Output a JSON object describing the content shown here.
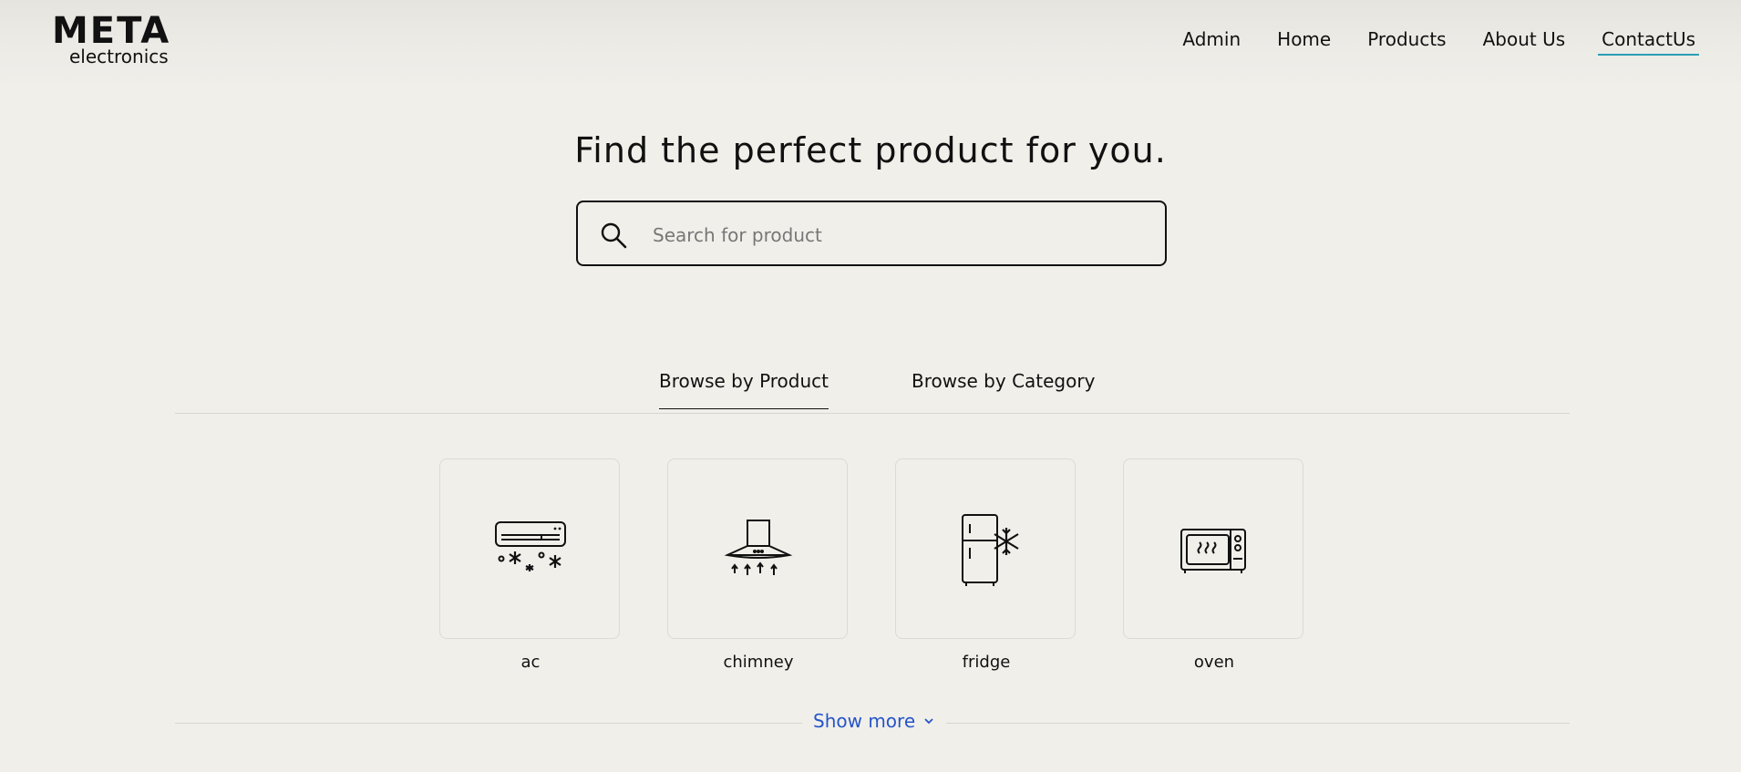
{
  "brand": {
    "name": "META",
    "sub": "electronics"
  },
  "nav": {
    "items": [
      {
        "label": "Admin"
      },
      {
        "label": "Home"
      },
      {
        "label": "Products"
      },
      {
        "label": "About Us"
      },
      {
        "label": "ContactUs",
        "active": true
      }
    ],
    "active_underline_color": "#2a9fb5"
  },
  "hero": {
    "title": "Find the perfect product for you."
  },
  "search": {
    "placeholder": "Search for product",
    "value": "",
    "icon": "search-icon"
  },
  "tabs": [
    {
      "label": "Browse by Product",
      "active": true
    },
    {
      "label": "Browse by Category",
      "active": false
    }
  ],
  "products": [
    {
      "label": "ac",
      "icon": "air-conditioner-icon"
    },
    {
      "label": "chimney",
      "icon": "chimney-hood-icon"
    },
    {
      "label": "fridge",
      "icon": "fridge-icon"
    },
    {
      "label": "oven",
      "icon": "microwave-oven-icon"
    }
  ],
  "show_more": {
    "label": "Show more",
    "icon": "chevron-down-icon",
    "color": "#2655c9"
  },
  "colors": {
    "background": "#f0efea",
    "text": "#111111"
  }
}
